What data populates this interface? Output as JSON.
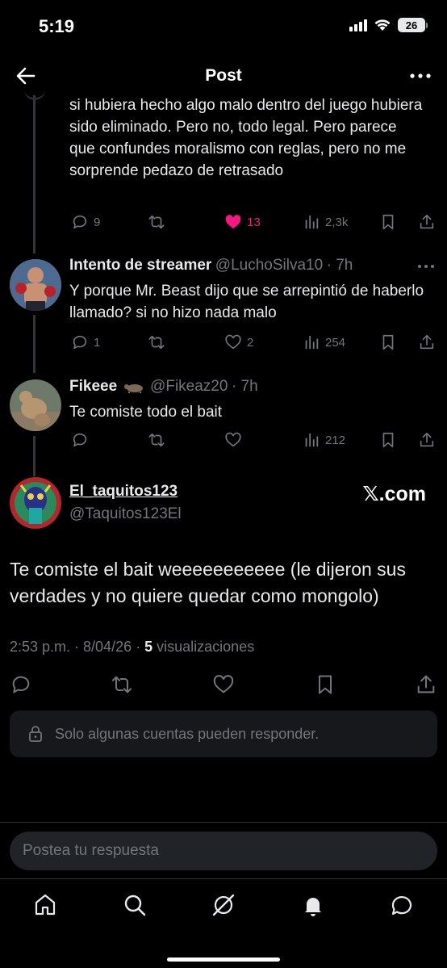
{
  "status_bar": {
    "time": "5:19",
    "battery": "26"
  },
  "header": {
    "title": "Post"
  },
  "parent_tweet": {
    "text": "si hubiera hecho algo malo dentro del juego hubiera sido eliminado. Pero no, todo legal. Pero parece que confundes moralismo con reglas, pero no me sorprende pedazo de retrasado",
    "replies": "9",
    "likes": "13",
    "views": "2,3k"
  },
  "reply1": {
    "name": "Intento de streamer",
    "handle": "@LuchoSilva10",
    "time": "· 7h",
    "text": "Y porque Mr. Beast dijo que se arrepintió de haberlo llamado? si no hizo nada malo",
    "replies": "1",
    "likes": "2",
    "views": "254"
  },
  "reply2": {
    "name": "Fikeee",
    "handle": "@Fikeaz20",
    "time": "· 7h",
    "text": "Te comiste todo el bait",
    "views": "212"
  },
  "main_tweet": {
    "name": "El_taquitos123",
    "handle": "@Taquitos123El",
    "watermark": "𝕏.com",
    "text": "Te comiste el bait weeeeeeeeeee (le dijeron sus verdades y no quiere quedar como mongolo)",
    "timestamp": "2:53 p.m. · 8/04/26 ·",
    "views_count": "5",
    "views_label": "visualizaciones"
  },
  "restriction_notice": "Solo algunas cuentas pueden responder.",
  "reply_input": {
    "placeholder": "Postea tu respuesta"
  },
  "colors": {
    "like_active": "#f91880",
    "muted": "#71767b",
    "text": "#e7e9ea"
  },
  "nav_icons": [
    "home-icon",
    "search-icon",
    "grok-icon",
    "notifications-icon",
    "messages-icon"
  ]
}
